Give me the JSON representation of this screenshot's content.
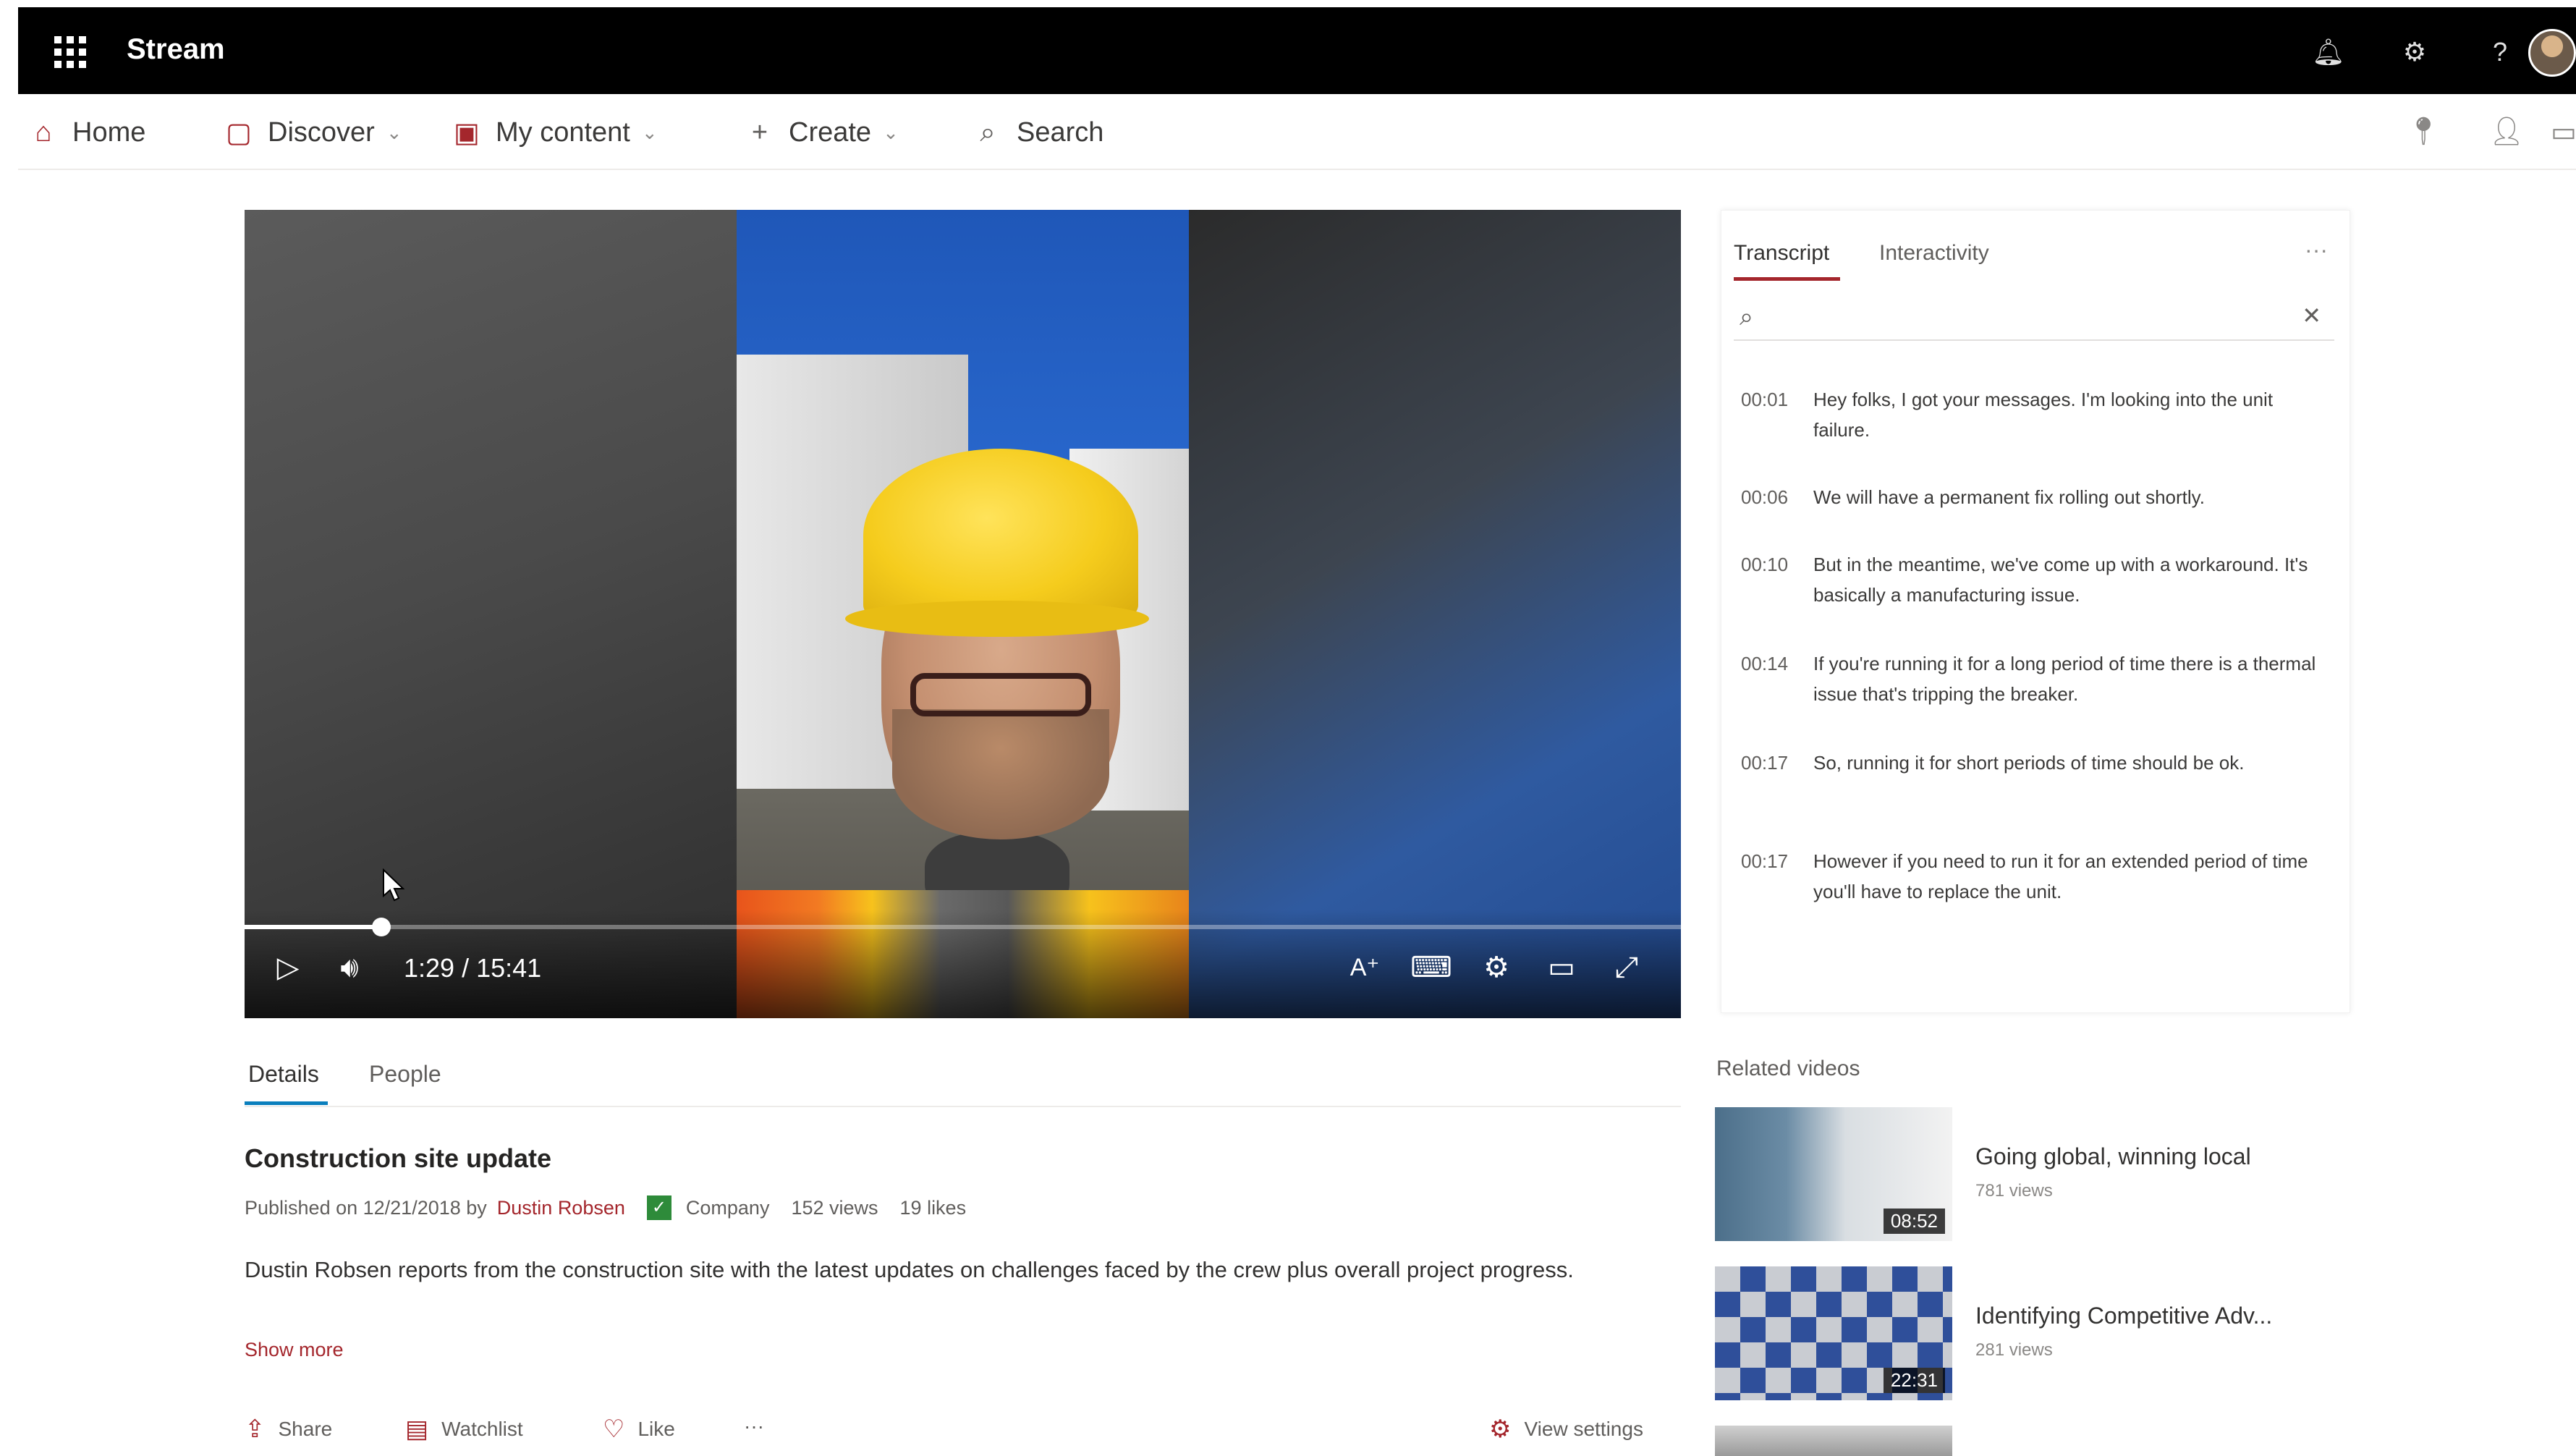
{
  "app": {
    "name": "Stream"
  },
  "nav": {
    "home": "Home",
    "discover": "Discover",
    "my_content": "My content",
    "create": "Create",
    "search": "Search"
  },
  "player": {
    "time": "1:29 / 15:41",
    "progress": 0.095
  },
  "transcript": {
    "tab_transcript": "Transcript",
    "tab_interactivity": "Interactivity",
    "search_placeholder": "",
    "entries": [
      {
        "ts": "00:01",
        "text": "Hey folks, I got your messages. I'm looking into the unit failure."
      },
      {
        "ts": "00:06",
        "text": "We will have a permanent fix rolling out shortly."
      },
      {
        "ts": "00:10",
        "text": "But in the meantime, we've come up with a workaround. It's basically a manufacturing issue."
      },
      {
        "ts": "00:14",
        "text": "If you're running it for a long period of time there is a thermal issue that's tripping the breaker."
      },
      {
        "ts": "00:17",
        "text": "So, running it for short periods of time should be ok."
      },
      {
        "ts": "00:17",
        "text": "However if you need to run it for an extended period of time you'll have to replace the unit."
      }
    ]
  },
  "details": {
    "tab_details": "Details",
    "tab_people": "People",
    "title": "Construction site update",
    "published_prefix": "Published on 12/21/2018 by",
    "author": "Dustin Robsen",
    "visibility": "Company",
    "views": "152 views",
    "likes": "19 likes",
    "description": "Dustin Robsen reports from the construction site with the latest updates on challenges faced by the crew plus overall project progress.",
    "show_more": "Show more",
    "actions": {
      "share": "Share",
      "watchlist": "Watchlist",
      "like": "Like",
      "more": "···",
      "view_settings": "View settings"
    }
  },
  "related": {
    "heading": "Related videos",
    "items": [
      {
        "title": "Going global, winning local",
        "views": "781 views",
        "duration": "08:52"
      },
      {
        "title": "Identifying Competitive Adv...",
        "views": "281 views",
        "duration": "22:31"
      }
    ]
  },
  "colors": {
    "accent": "#a4262c",
    "tab_underline": "#0a7fbd"
  }
}
